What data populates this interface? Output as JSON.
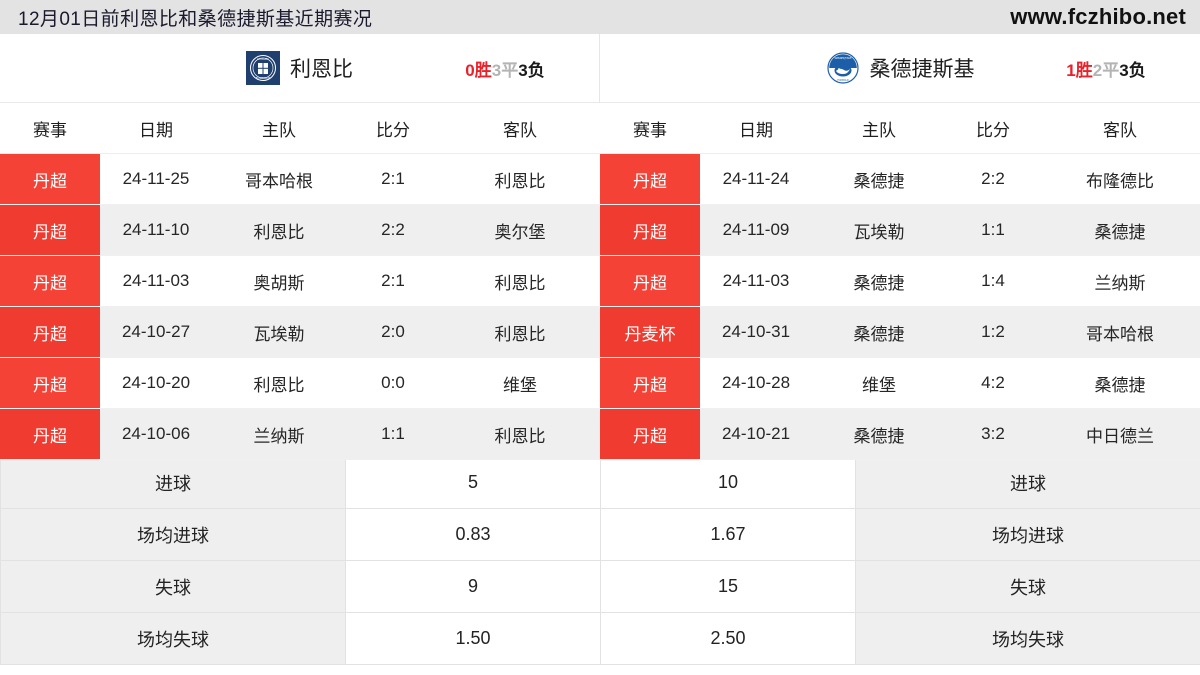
{
  "header": {
    "title": "12月01日前利恩比和桑德捷斯基近期赛况",
    "site": "www.fczhibo.net"
  },
  "columns": [
    "赛事",
    "日期",
    "主队",
    "比分",
    "客队"
  ],
  "teams": [
    {
      "name": "利恩比",
      "logo_icon": "lyngby-crest-icon",
      "logo_colors": {
        "bg": "#1f3f6e",
        "fg": "#ffffff"
      },
      "record": {
        "wins": "0胜",
        "draws": "3平",
        "losses": "3负"
      },
      "matches": [
        {
          "league": "丹超",
          "date": "24-11-25",
          "home": "哥本哈根",
          "score": "2:1",
          "away": "利恩比"
        },
        {
          "league": "丹超",
          "date": "24-11-10",
          "home": "利恩比",
          "score": "2:2",
          "away": "奥尔堡"
        },
        {
          "league": "丹超",
          "date": "24-11-03",
          "home": "奥胡斯",
          "score": "2:1",
          "away": "利恩比"
        },
        {
          "league": "丹超",
          "date": "24-10-27",
          "home": "瓦埃勒",
          "score": "2:0",
          "away": "利恩比"
        },
        {
          "league": "丹超",
          "date": "24-10-20",
          "home": "利恩比",
          "score": "0:0",
          "away": "维堡"
        },
        {
          "league": "丹超",
          "date": "24-10-06",
          "home": "兰纳斯",
          "score": "1:1",
          "away": "利恩比"
        }
      ]
    },
    {
      "name": "桑德捷斯基",
      "logo_icon": "soenderjyske-crest-icon",
      "logo_colors": {
        "bg": "#ffffff",
        "fg": "#1c5fa8"
      },
      "record": {
        "wins": "1胜",
        "draws": "2平",
        "losses": "3负"
      },
      "matches": [
        {
          "league": "丹超",
          "date": "24-11-24",
          "home": "桑德捷",
          "score": "2:2",
          "away": "布隆德比"
        },
        {
          "league": "丹超",
          "date": "24-11-09",
          "home": "瓦埃勒",
          "score": "1:1",
          "away": "桑德捷"
        },
        {
          "league": "丹超",
          "date": "24-11-03",
          "home": "桑德捷",
          "score": "1:4",
          "away": "兰纳斯"
        },
        {
          "league": "丹麦杯",
          "date": "24-10-31",
          "home": "桑德捷",
          "score": "1:2",
          "away": "哥本哈根"
        },
        {
          "league": "丹超",
          "date": "24-10-28",
          "home": "维堡",
          "score": "4:2",
          "away": "桑德捷"
        },
        {
          "league": "丹超",
          "date": "24-10-21",
          "home": "桑德捷",
          "score": "3:2",
          "away": "中日德兰"
        }
      ]
    }
  ],
  "stats": [
    {
      "label_left": "进球",
      "left": "5",
      "right": "10",
      "label_right": "进球"
    },
    {
      "label_left": "场均进球",
      "left": "0.83",
      "right": "1.67",
      "label_right": "场均进球"
    },
    {
      "label_left": "失球",
      "left": "9",
      "right": "15",
      "label_right": "失球"
    },
    {
      "label_left": "场均失球",
      "left": "1.50",
      "right": "2.50",
      "label_right": "场均失球"
    }
  ],
  "colors": {
    "league_badge": "#f44336",
    "league_badge_alt": "#ef3b30",
    "win": "#e8212a",
    "draw": "#b4b4b4",
    "loss": "#1a1a1a",
    "topbar_bg": "#e3e3e3",
    "row_alt_bg": "#efefef"
  }
}
